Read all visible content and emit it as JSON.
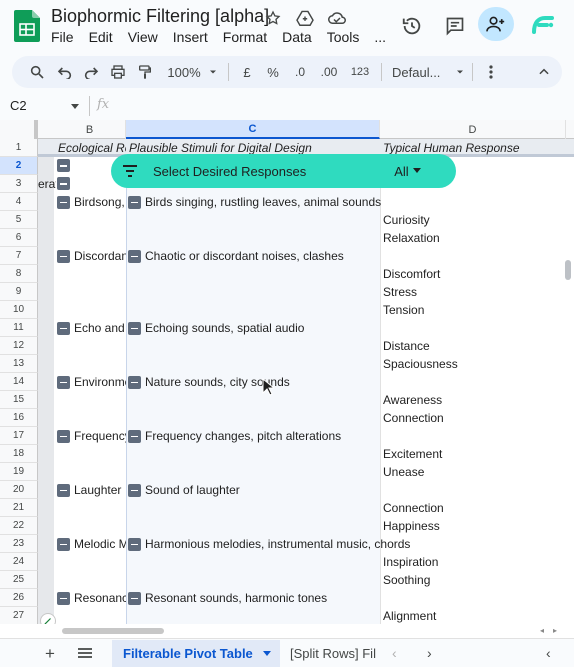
{
  "app": {
    "title": "Biophormic Filtering [alpha]",
    "menu": [
      "File",
      "Edit",
      "View",
      "Insert",
      "Format",
      "Data",
      "Tools",
      "..."
    ]
  },
  "toolbar": {
    "zoom": "100%",
    "currency": "£",
    "percent": "%",
    "dec_decrease": ".0",
    "dec_increase": ".00",
    "number_format": "123",
    "font": "Defaul..."
  },
  "formula_bar": {
    "cell_ref": "C2",
    "fx": "fx",
    "value": ""
  },
  "columns": [
    "B",
    "C",
    "D"
  ],
  "header_row": {
    "b": "Ecological Re",
    "c": "Plausible Stimuli for Digital Design",
    "d": "Typical Human Response"
  },
  "filter": {
    "label": "Select Desired Responses",
    "value": "All"
  },
  "rows": [
    {
      "n": "1"
    },
    {
      "n": "2"
    },
    {
      "n": "3",
      "a": "erat"
    },
    {
      "n": "4",
      "b": "Birdsong,",
      "c": "Birds singing, rustling leaves, animal sounds"
    },
    {
      "n": "5",
      "d": "Curiosity"
    },
    {
      "n": "6",
      "d": "Relaxation"
    },
    {
      "n": "7",
      "b": "Discordan",
      "c": "Chaotic or discordant noises, clashes"
    },
    {
      "n": "8",
      "d": "Discomfort"
    },
    {
      "n": "9",
      "d": "Stress"
    },
    {
      "n": "10",
      "d": "Tension"
    },
    {
      "n": "11",
      "b": "Echo and",
      "c": "Echoing sounds, spatial audio"
    },
    {
      "n": "12",
      "d": "Distance"
    },
    {
      "n": "13",
      "d": "Spaciousness"
    },
    {
      "n": "14",
      "b": "Environme",
      "c": "Nature sounds, city sounds"
    },
    {
      "n": "15",
      "d": "Awareness"
    },
    {
      "n": "16",
      "d": "Connection"
    },
    {
      "n": "17",
      "b": "Frequency",
      "c": "Frequency changes, pitch alterations"
    },
    {
      "n": "18",
      "d": "Excitement"
    },
    {
      "n": "19",
      "d": "Unease"
    },
    {
      "n": "20",
      "b": "Laughter",
      "c": "Sound of laughter"
    },
    {
      "n": "21",
      "d": "Connection"
    },
    {
      "n": "22",
      "d": "Happiness"
    },
    {
      "n": "23",
      "b": "Melodic M",
      "c": "Harmonious melodies, instrumental music, chords"
    },
    {
      "n": "24",
      "d": "Inspiration"
    },
    {
      "n": "25",
      "d": "Soothing"
    },
    {
      "n": "26",
      "b": "Resonanc",
      "c": "Resonant sounds, harmonic tones"
    },
    {
      "n": "27",
      "d": "Alignment"
    }
  ],
  "sheets": {
    "active": "Filterable Pivot Table",
    "other": "[Split Rows] Fil"
  },
  "colors": {
    "accent": "#2fdbbf",
    "share": "#c2e7ff",
    "active_tab": "#0b57d0"
  }
}
